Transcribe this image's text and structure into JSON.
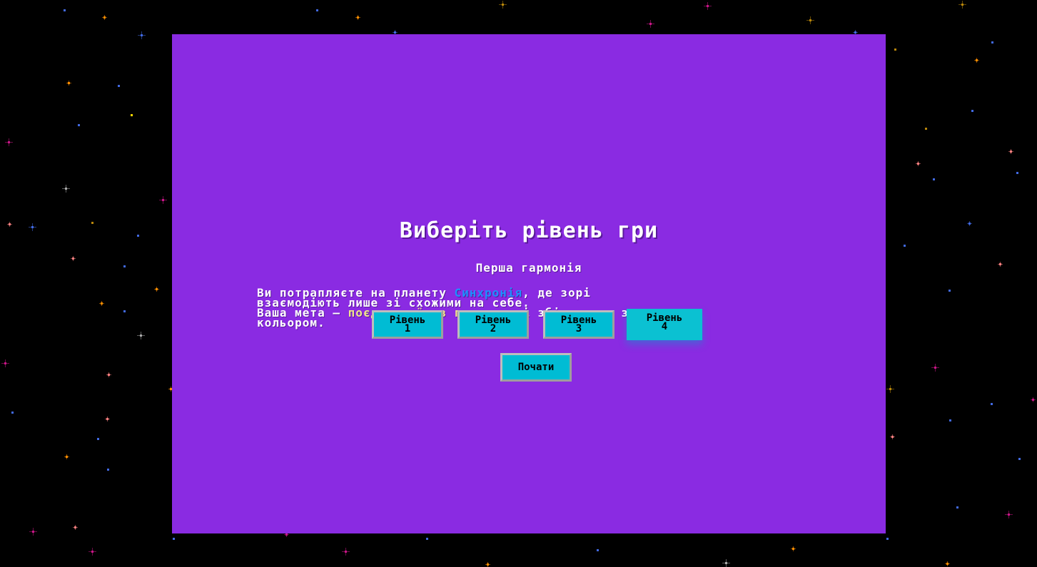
{
  "title": "Виберіть рівень гри",
  "subtitle": "Перша гармонія",
  "story": {
    "line1_prefix": "Ви потрапляєте на планету ",
    "planet_name": "Синхронія",
    "line1_suffix": ", де зорі",
    "line2": "взаємодіють лише зі схожими на себе.",
    "line3_prefix": "Ваша мета — ",
    "goal": "поєднати їх в групи",
    "line3_suffix": ", які збігаються за",
    "line4": "кольором."
  },
  "levels": [
    {
      "label": "Рівень",
      "number": "1",
      "selected": false
    },
    {
      "label": "Рівень",
      "number": "2",
      "selected": false
    },
    {
      "label": "Рівень",
      "number": "3",
      "selected": false
    },
    {
      "label": "Рівень",
      "number": "4",
      "selected": true
    }
  ],
  "start_button": {
    "label": "Почати"
  },
  "colors": {
    "panel": "#8a2be2",
    "button": "#00bcd4",
    "planet_highlight": "#1e90ff",
    "goal_highlight": "#f0e68c",
    "background": "#000000"
  }
}
